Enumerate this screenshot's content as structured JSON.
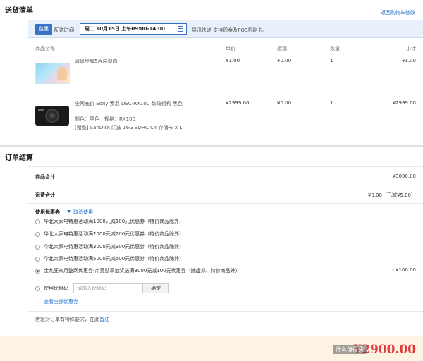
{
  "delivery": {
    "title": "送货清单",
    "back_link": "返回购物车修改",
    "tag": "包裹",
    "time_label": "配送时间",
    "date_value": "周二 10月15日 上午09:00-14:00",
    "service_note": "易迅快递 支持现金及POS机刷卡。"
  },
  "table": {
    "headers": [
      "商品名称",
      "单价",
      "返现",
      "数量",
      "小计"
    ],
    "items": [
      {
        "name": "清风步履5片装湿巾",
        "price": "¥1.00",
        "cashback": "¥0.00",
        "qty": "1",
        "subtotal": "¥1.00"
      },
      {
        "name": "全网底价 Sony 索尼 DSC-RX100 数码相机 黑色",
        "price": "¥2999.00",
        "cashback": "¥0.00",
        "qty": "1",
        "subtotal": "¥2999.00",
        "attrs": "颜色：黑色　规格：RX100",
        "gift": "[赠品] SanDisk 闪迪 16G SDHC C4 存储卡 x 1"
      }
    ]
  },
  "summary": {
    "title": "订单结算",
    "goods_total_label": "商品合计",
    "goods_total_value": "¥3000.00",
    "shipping_label": "运费合计",
    "shipping_value": "¥0.00（已减¥5.00）",
    "coupon_label": "使用优惠券",
    "cancel_coupon": "取消使用",
    "coupons": [
      {
        "text": "华北大家电特惠活动满1000元减100元优惠券（特价商品除外）",
        "checked": false,
        "discount": ""
      },
      {
        "text": "华北大家电特惠活动满2000元减200元优惠券（特价商品除外）",
        "checked": false,
        "discount": ""
      },
      {
        "text": "华北大家电特惠活动满3000元减300元优惠券（特价商品除外）",
        "checked": false,
        "discount": ""
      },
      {
        "text": "华北大家电特惠活动满5000元减500元优惠券（特价商品除外）",
        "checked": false,
        "discount": ""
      },
      {
        "text": "金九狂欢月整网优惠券-点亮勋章抽奖送满3000元减100元优惠券（除虚拟、特价商品外）",
        "checked": true,
        "discount": "- ¥100.00"
      }
    ],
    "coupon_code_label": "使用优惠码",
    "coupon_code_placeholder": "请输入优惠码",
    "confirm_label": "确定",
    "all_coupons_link": "查看全部优惠券",
    "remark_prefix": "若您对订单有特殊要求，在此",
    "remark_link": "备注"
  },
  "footer": {
    "total": "¥2900.00",
    "watermark": "什么值得买"
  }
}
